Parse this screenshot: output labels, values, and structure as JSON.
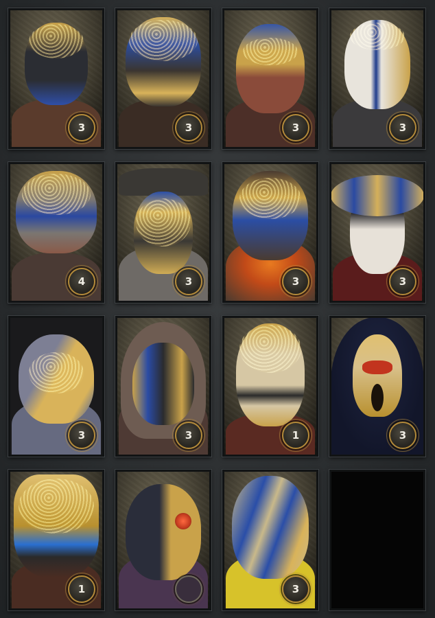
{
  "cards": [
    {
      "id": "mask-1",
      "count": "3",
      "colors": {
        "mask": "#2b2d33",
        "accent": "#c9a24a",
        "trim": "#2f4fa8",
        "body": "#5a3b2c"
      }
    },
    {
      "id": "mask-2",
      "count": "3",
      "colors": {
        "mask": "#3a3530",
        "accent": "#d9b35a",
        "trim": "#2c4ea0",
        "body": "#3a2c24"
      }
    },
    {
      "id": "mask-3",
      "count": "3",
      "colors": {
        "mask": "#8a4b3a",
        "accent": "#c9a24a",
        "trim": "#3656a6",
        "body": "#4c2f28"
      }
    },
    {
      "id": "mask-4",
      "count": "3",
      "colors": {
        "mask": "#e8e4dc",
        "accent": "#c9a24a",
        "trim": "#1f3c8c",
        "body": "#3b3a3c"
      }
    },
    {
      "id": "mask-5",
      "count": "4",
      "colors": {
        "mask": "#7a7672",
        "accent": "#c9a24a",
        "trim": "#2a48a0",
        "body": "#4a3a34"
      }
    },
    {
      "id": "mask-6",
      "count": "3",
      "colors": {
        "mask": "#3a3834",
        "accent": "#d0ac55",
        "trim": "#2b4fa8",
        "body": "#6e6a66"
      }
    },
    {
      "id": "mask-7",
      "count": "3",
      "colors": {
        "mask": "#4a3b30",
        "accent": "#c9a24a",
        "trim": "#2b4ea4",
        "body": "#c24a18"
      }
    },
    {
      "id": "mask-8",
      "count": "3",
      "colors": {
        "mask": "#e7e1d8",
        "accent": "#d5b05a",
        "trim": "#2a4aa2",
        "body": "#5a1c1c"
      }
    },
    {
      "id": "mask-9",
      "count": "3",
      "colors": {
        "mask": "#7d7f94",
        "accent": "#d9b35a",
        "trim": "#2c4ea8",
        "body": "#666a80"
      }
    },
    {
      "id": "mask-10",
      "count": "3",
      "colors": {
        "mask": "#2a2b2e",
        "accent": "#c9a24a",
        "trim": "#2a4ba4",
        "body": "#4e3a34"
      }
    },
    {
      "id": "mask-11",
      "count": "1",
      "colors": {
        "mask": "#d6c7a4",
        "accent": "#c9a24a",
        "trim": "#2b2b2b",
        "body": "#5a2a22"
      }
    },
    {
      "id": "mask-12",
      "count": "3",
      "colors": {
        "mask": "#d8c08a",
        "accent": "#e0c070",
        "trim": "#c2341e",
        "body": "#1e2440"
      }
    },
    {
      "id": "mask-13",
      "count": "1",
      "colors": {
        "mask": "#b8902f",
        "accent": "#e0c070",
        "trim": "#2a6fd0",
        "body": "#4a2c22"
      }
    },
    {
      "id": "mask-14",
      "count": "",
      "colors": {
        "mask": "#2a2d3a",
        "accent": "#c9a24a",
        "trim": "#c23a1e",
        "body": "#4a3550"
      }
    },
    {
      "id": "mask-15",
      "count": "3",
      "colors": {
        "mask": "#c9b98a",
        "accent": "#d9b35a",
        "trim": "#2a4ea8",
        "body": "#d7c22a"
      }
    },
    {
      "id": "mask-16",
      "count": "",
      "empty": true
    }
  ]
}
